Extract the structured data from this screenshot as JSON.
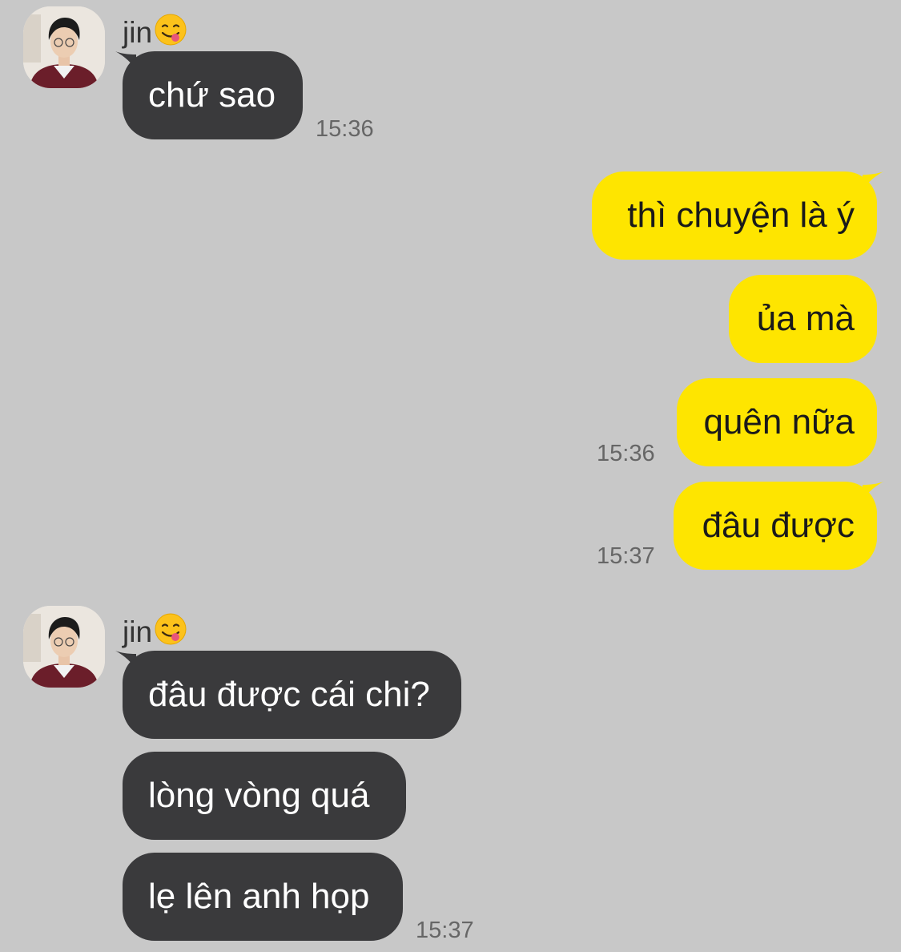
{
  "colors": {
    "background": "#c8c8c8",
    "incoming_bubble": "#3a3a3c",
    "outgoing_bubble": "#fee500"
  },
  "groups": [
    {
      "sender": "jin",
      "sender_emoji": "face-savoring-food-emoji",
      "avatar": "contact-avatar-photo",
      "messages": [
        "chứ sao"
      ],
      "time": "15:36"
    },
    {
      "direction": "outgoing",
      "messages": [
        "thì chuyện là ý",
        "ủa mà",
        "quên nữa"
      ],
      "time": "15:36"
    },
    {
      "direction": "outgoing",
      "messages": [
        "đâu được"
      ],
      "time": "15:37"
    },
    {
      "sender": "jin",
      "sender_emoji": "face-savoring-food-emoji",
      "avatar": "contact-avatar-photo",
      "messages": [
        "đâu được cái chi?",
        "lòng vòng quá",
        "lẹ lên anh họp"
      ],
      "time": "15:37"
    }
  ]
}
